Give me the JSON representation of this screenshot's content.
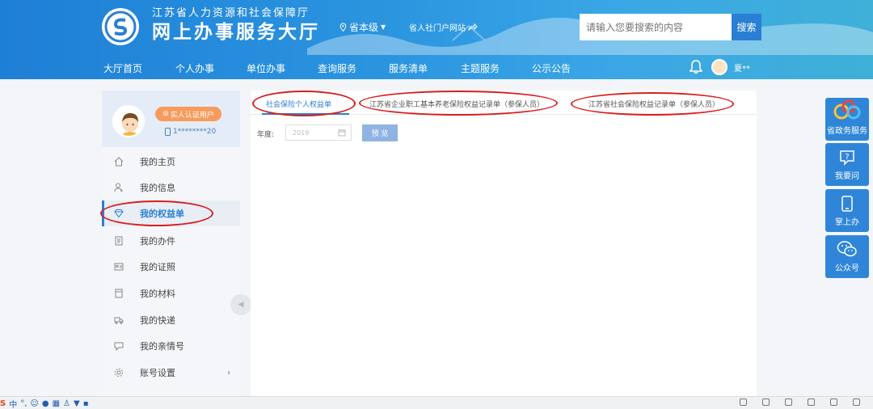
{
  "header": {
    "title_sub": "江苏省人力资源和社会保障厅",
    "title_main": "网上办事服务大厅",
    "region": "省本级",
    "portal_link": "省人社门户网站",
    "search_placeholder": "请输入您要搜索的内容",
    "search_button": "搜索",
    "username": "夏**"
  },
  "nav": [
    "大厅首页",
    "个人办事",
    "单位办事",
    "查询服务",
    "服务清单",
    "主题服务",
    "公示公告"
  ],
  "profile": {
    "verified_badge": "实人认证用户",
    "phone": "1********20"
  },
  "sidebar": {
    "items": [
      {
        "label": "我的主页",
        "icon": "home-icon"
      },
      {
        "label": "我的信息",
        "icon": "person-icon"
      },
      {
        "label": "我的权益单",
        "icon": "diamond-icon",
        "active": true
      },
      {
        "label": "我的办件",
        "icon": "document-icon"
      },
      {
        "label": "我的证照",
        "icon": "id-card-icon"
      },
      {
        "label": "我的材料",
        "icon": "folder-icon"
      },
      {
        "label": "我的快递",
        "icon": "truck-icon"
      },
      {
        "label": "我的亲情号",
        "icon": "family-icon"
      },
      {
        "label": "账号设置",
        "icon": "gear-icon",
        "arrow": "›"
      }
    ]
  },
  "tabs": [
    {
      "label": "社会保险个人权益单",
      "active": true
    },
    {
      "label": "江苏省企业职工基本养老保险权益记录单（参保人员）"
    },
    {
      "label": "江苏省社会保险权益记录单（参保人员）"
    }
  ],
  "form": {
    "year_label": "年度:",
    "year_value": "2019",
    "preview_button": "预 览"
  },
  "float_buttons": [
    {
      "label": "省政务服务",
      "icon": "gov-service-icon"
    },
    {
      "label": "我要问",
      "icon": "question-icon"
    },
    {
      "label": "掌上办",
      "icon": "phone-icon"
    },
    {
      "label": "公众号",
      "icon": "wechat-icon"
    }
  ],
  "taskbar": {
    "ime_label": "中"
  },
  "colors": {
    "header_blue": "#2b95df",
    "accent": "#2a7fd4",
    "badge_orange": "#f79b5d",
    "annotation_red": "#d81e1e"
  }
}
